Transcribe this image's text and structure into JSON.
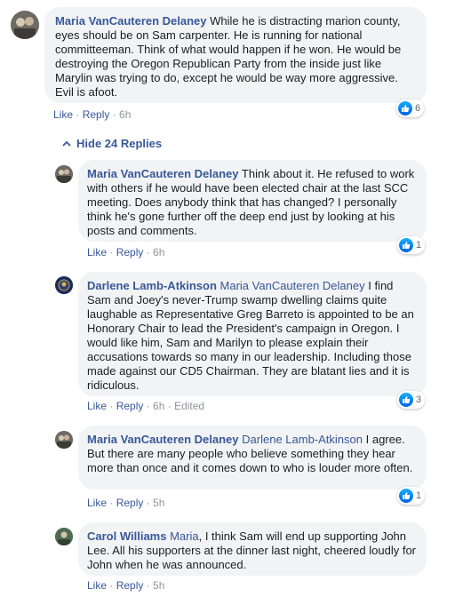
{
  "comments": [
    {
      "author": "Maria VanCauteren Delaney",
      "mention": "",
      "text": " While he is distracting marion county, eyes should be on Sam carpenter. He is running for national committeeman. Think of what would happen if he won. He would be destroying the Oregon Republican Party from the inside just like Marylin was trying to do, except he would be way more aggressive. Evil is afoot.",
      "like_label": "Like",
      "reply_label": "Reply",
      "time": "6h",
      "edited": "",
      "reactions": "6",
      "avatar_color": "#6d6a63"
    },
    {
      "author": "Maria VanCauteren Delaney",
      "mention": "",
      "text": " Think about it. He refused to work with others if he would have been elected chair at the last SCC meeting. Does anybody think that has changed? I personally think he's gone further off the deep end just by looking at his posts and comments.",
      "like_label": "Like",
      "reply_label": "Reply",
      "time": "6h",
      "edited": "",
      "reactions": "1",
      "avatar_color": "#6d6a63"
    },
    {
      "author": "Darlene Lamb-Atkinson",
      "mention": " Maria VanCauteren Delaney",
      "text": " I find Sam and Joey's never-Trump swamp dwelling claims quite laughable as Representative Greg Barreto is appointed to be an Honorary Chair to lead the President's campaign in Oregon. I would like him, Sam and Marilyn to please explain their accusations towards so many in our leadership. Including those made against our CD5 Chairman. They are blatant lies and it is ridiculous.",
      "like_label": "Like",
      "reply_label": "Reply",
      "time": "6h",
      "edited": "Edited",
      "reactions": "3",
      "avatar_color": "#1b2a5e"
    },
    {
      "author": "Maria VanCauteren Delaney",
      "mention": " Darlene Lamb-Atkinson",
      "text": " I agree. But there are many people who believe something they hear more than once and it comes down to who is louder more often.",
      "like_label": "Like",
      "reply_label": "Reply",
      "time": "5h",
      "edited": "",
      "reactions": "1",
      "avatar_color": "#6d6a63"
    },
    {
      "author": "Carol Williams",
      "mention": " Maria",
      "text": ", I think Sam will end up supporting John Lee. All his supporters at the dinner last night, cheered loudly for John when he was announced.",
      "like_label": "Like",
      "reply_label": "Reply",
      "time": "5h",
      "edited": "",
      "reactions": "",
      "avatar_color": "#4f6b52"
    }
  ],
  "replies_toggle": {
    "label": "Hide 24 Replies"
  },
  "icons": {
    "like": "like-icon",
    "chevron": "chevron-up-icon",
    "avatar": "avatar"
  },
  "colors": {
    "link": "#385898",
    "bubble": "#f2f3f5",
    "meta": "#90949c",
    "like_blue": "#1877f2"
  }
}
